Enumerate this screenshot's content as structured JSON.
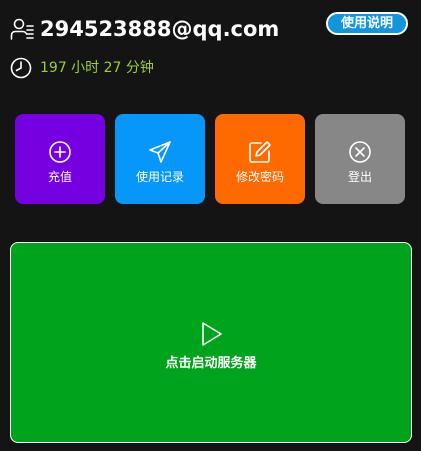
{
  "account": {
    "email": "294523888@qq.com",
    "help_label": "使用说明",
    "remaining_time": "197 小时 27 分钟"
  },
  "tiles": [
    {
      "label": "充值",
      "icon": "plus-circle-icon",
      "color": "#7500e0"
    },
    {
      "label": "使用记录",
      "icon": "paper-plane-icon",
      "color": "#0796fa"
    },
    {
      "label": "修改密码",
      "icon": "edit-icon",
      "color": "#ff6a00"
    },
    {
      "label": "登出",
      "icon": "close-circle-icon",
      "color": "#878787"
    }
  ],
  "start": {
    "label": "点击启动服务器",
    "icon": "play-icon",
    "color": "#00a31c"
  },
  "colors": {
    "background": "#141414",
    "time_text": "#9acd32",
    "help_button": "#1296db"
  }
}
